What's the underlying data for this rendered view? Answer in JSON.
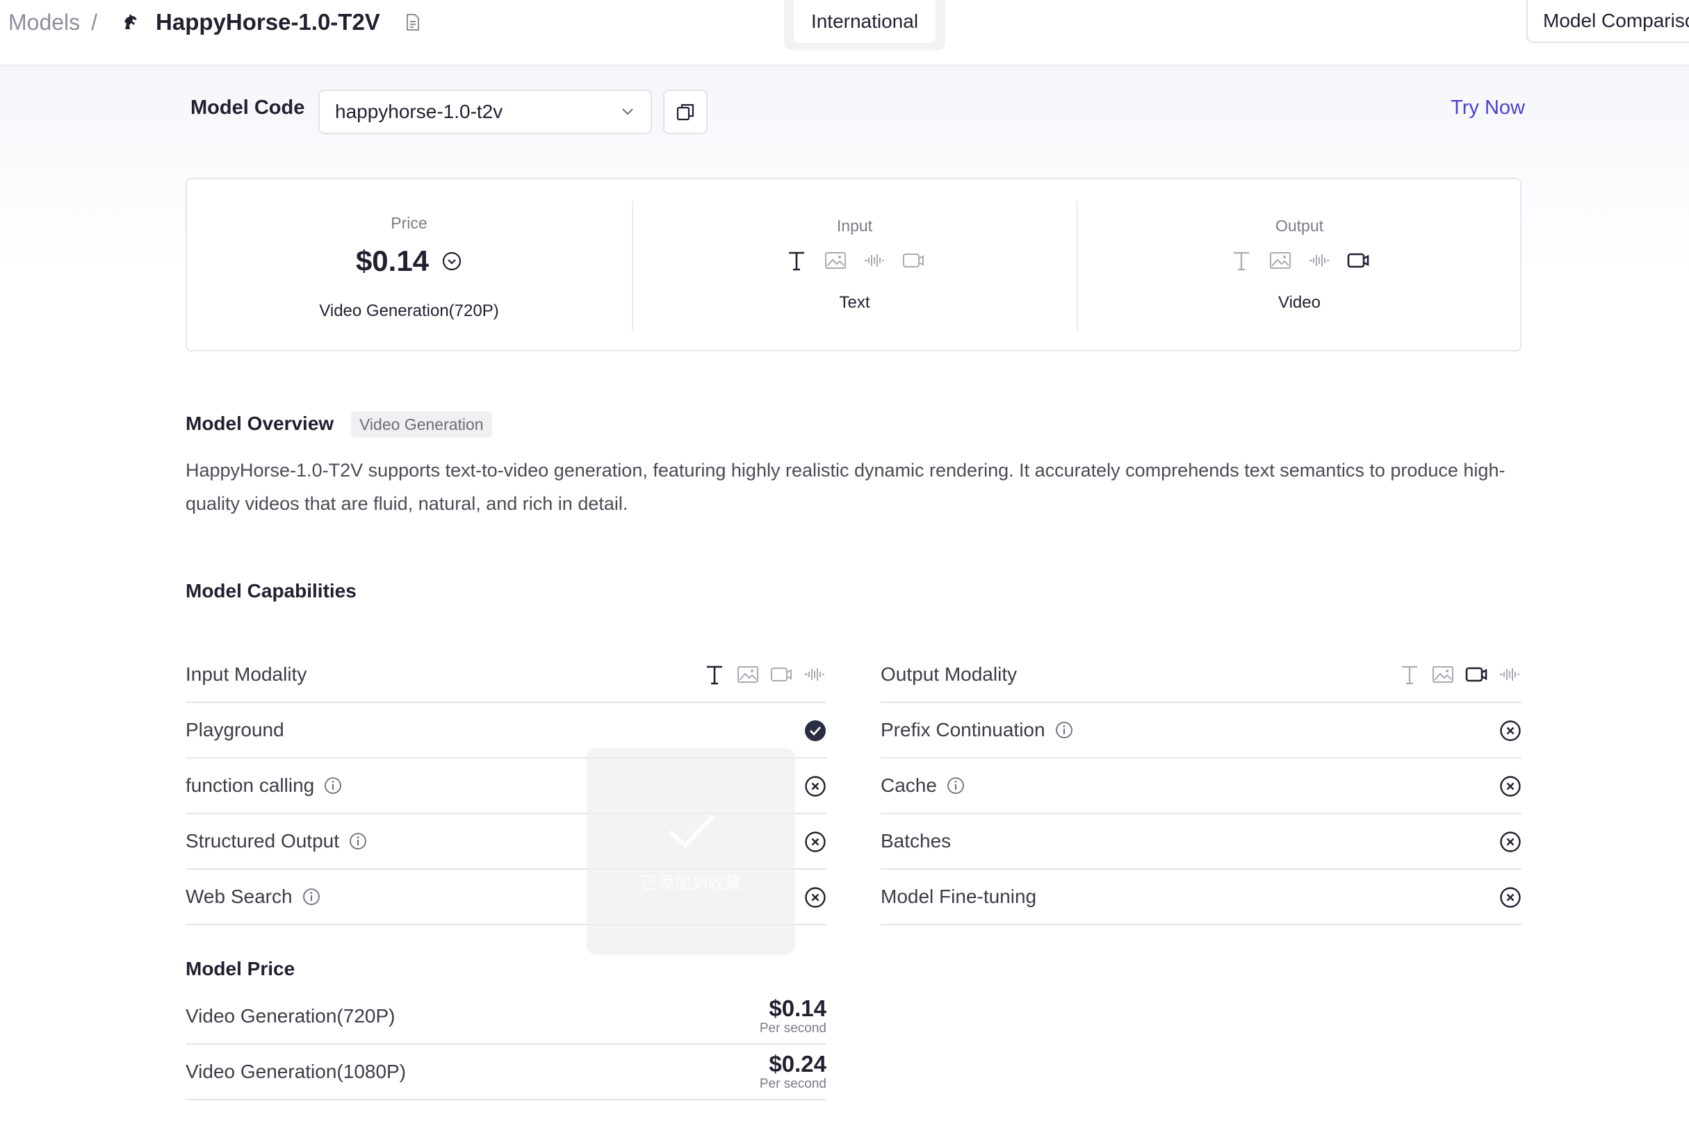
{
  "header": {
    "breadcrumb_root": "Models",
    "breadcrumb_separator": "/",
    "model_title": "HappyHorse-1.0-T2V",
    "region_tab": "International",
    "compare_button": "Model Comparison"
  },
  "model_code": {
    "label": "Model Code",
    "selected": "happyhorse-1.0-t2v",
    "try_now": "Try Now"
  },
  "summary": {
    "price_label": "Price",
    "price_value": "$0.14",
    "price_caption": "Video Generation(720P)",
    "input_label": "Input",
    "input_caption": "Text",
    "input_icons": [
      "text-icon",
      "image-icon",
      "audio-icon",
      "video-icon"
    ],
    "input_active": "text-icon",
    "output_label": "Output",
    "output_caption": "Video",
    "output_icons": [
      "text-icon",
      "image-icon",
      "audio-icon",
      "video-icon"
    ],
    "output_active": "video-icon"
  },
  "overview": {
    "title": "Model Overview",
    "tag": "Video Generation",
    "text": "HappyHorse-1.0-T2V supports text-to-video generation, featuring highly realistic dynamic rendering. It accurately comprehends text semantics to produce high-quality videos that are fluid, natural, and rich in detail."
  },
  "capabilities": {
    "title": "Model Capabilities",
    "left": [
      {
        "label": "Input Modality",
        "type": "modality",
        "icons": [
          "text-icon",
          "image-icon",
          "video-icon",
          "audio-icon"
        ],
        "active": "text-icon"
      },
      {
        "label": "Playground",
        "status": "supported",
        "info": false
      },
      {
        "label": "function calling",
        "status": "unsupported",
        "info": true
      },
      {
        "label": "Structured Output",
        "status": "unsupported",
        "info": true
      },
      {
        "label": "Web Search",
        "status": "unsupported",
        "info": true
      }
    ],
    "right": [
      {
        "label": "Output Modality",
        "type": "modality",
        "icons": [
          "text-icon",
          "image-icon",
          "video-icon",
          "audio-icon"
        ],
        "active": "video-icon"
      },
      {
        "label": "Prefix Continuation",
        "status": "unsupported",
        "info": true
      },
      {
        "label": "Cache",
        "status": "unsupported",
        "info": true
      },
      {
        "label": "Batches",
        "status": "unsupported",
        "info": false
      },
      {
        "label": "Model Fine-tuning",
        "status": "unsupported",
        "info": false
      }
    ]
  },
  "toast": {
    "text": "已添加到收藏"
  },
  "pricing": {
    "title": "Model Price",
    "rows": [
      {
        "name": "Video Generation(720P)",
        "amount": "$0.14",
        "unit": "Per second"
      },
      {
        "name": "Video Generation(1080P)",
        "amount": "$0.24",
        "unit": "Per second"
      }
    ]
  },
  "colors": {
    "accent": "#4d3fd6",
    "text_primary": "#1f2130",
    "icon_muted": "#a9aab3",
    "icon_active": "#1f2130"
  }
}
